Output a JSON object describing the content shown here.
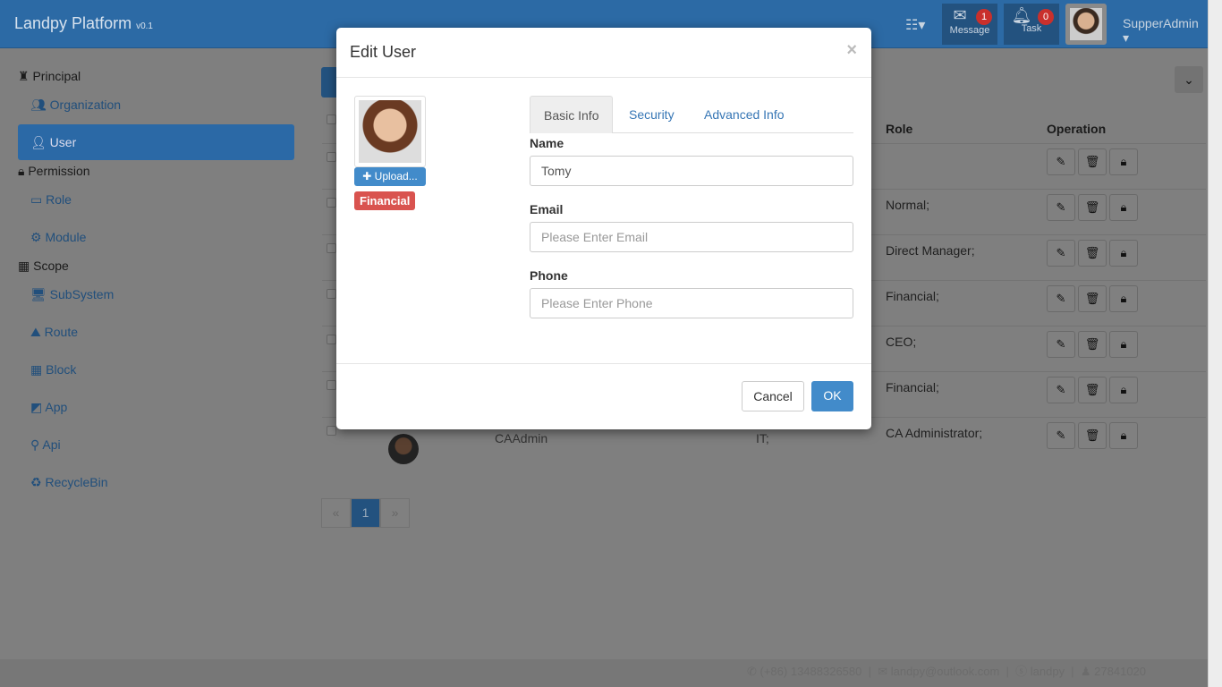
{
  "navbar": {
    "brand": "Landpy Platform",
    "version": "v0.1",
    "message_label": "Message",
    "message_count": "1",
    "task_label": "Task",
    "task_count": "0",
    "user": "SupperAdmin"
  },
  "sidebar": {
    "groups": [
      {
        "label": "Principal",
        "items": [
          "Organization",
          "User"
        ]
      },
      {
        "label": "Permission",
        "items": [
          "Role",
          "Module"
        ]
      },
      {
        "label": "Scope",
        "items": [
          "SubSystem",
          "Route",
          "Block",
          "App",
          "Api",
          "RecycleBin"
        ]
      }
    ],
    "active": "User"
  },
  "table": {
    "headers": {
      "role": "Role",
      "operation": "Operation"
    },
    "rows": [
      {
        "role": ""
      },
      {
        "role": "Normal;"
      },
      {
        "role": "Direct Manager;"
      },
      {
        "role": "Financial;"
      },
      {
        "role": "CEO;"
      },
      {
        "role": "Financial;"
      },
      {
        "role": "CA Administrator;",
        "name": "CAAdmin",
        "dept": "IT;"
      }
    ]
  },
  "pagination": {
    "prev": "«",
    "current": "1",
    "next": "»"
  },
  "modal": {
    "title": "Edit User",
    "close": "×",
    "upload": "Upload...",
    "role_tag": "Financial",
    "tabs": [
      "Basic Info",
      "Security",
      "Advanced Info"
    ],
    "active_tab": "Basic Info",
    "fields": {
      "name_label": "Name",
      "name_value": "Tomy",
      "email_label": "Email",
      "email_placeholder": "Please Enter Email",
      "phone_label": "Phone",
      "phone_placeholder": "Please Enter Phone"
    },
    "cancel": "Cancel",
    "ok": "OK"
  },
  "footer": {
    "phone": "(+86) 13488326580",
    "email": "landpy@outlook.com",
    "skype": "landpy",
    "qq": "27841020"
  },
  "colors": {
    "primary": "#428bca",
    "danger": "#d9534f",
    "navbar": "#2c6aa5"
  }
}
